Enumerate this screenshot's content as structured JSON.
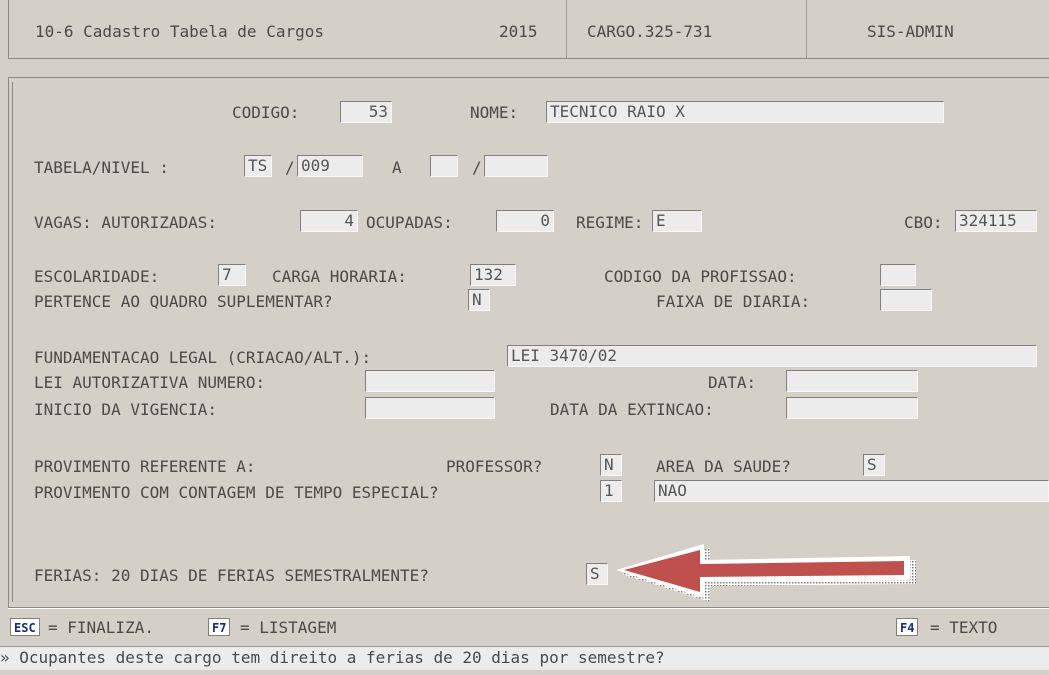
{
  "header": {
    "title": "10-6 Cadastro Tabela de Cargos",
    "year": "2015",
    "code": "CARGO.325-731",
    "user": "SIS-ADMIN"
  },
  "form": {
    "codigo": {
      "label": "CODIGO:",
      "value": "53"
    },
    "nome": {
      "label": "NOME:",
      "value": "TECNICO RAIO X"
    },
    "tabela": {
      "label": "TABELA/NIVEL : ",
      "tabela_value": "TS",
      "sep1": "/",
      "nivel_value": "009",
      "a_label": "A",
      "sep2": "/",
      "tabela_to": "",
      "nivel_to": ""
    },
    "vagas": {
      "label": "VAGAS: AUTORIZADAS:",
      "autorizadas": "4",
      "ocupadas_label": "OCUPADAS:",
      "ocupadas": "0",
      "regime_label": "REGIME:",
      "regime": "E",
      "cbo_label": "CBO:",
      "cbo": "324115"
    },
    "escolaridade": {
      "label": "ESCOLARIDADE:",
      "value": "7",
      "carga_label": "CARGA HORARIA:",
      "carga": "132",
      "prof_label": "CODIGO DA PROFISSAO:",
      "prof": ""
    },
    "suplementar": {
      "label": "PERTENCE AO QUADRO SUPLEMENTAR?",
      "value": "N",
      "faixa_label": "FAIXA DE DIARIA:",
      "faixa": ""
    },
    "legal": {
      "fund_label": "FUNDAMENTACAO LEGAL (CRIACAO/ALT.):",
      "fund": "LEI 3470/02",
      "lei_label": "LEI AUTORIZATIVA NUMERO:",
      "lei": "",
      "data_label": "DATA:",
      "data": "",
      "inicio_label": "INICIO DA VIGENCIA:",
      "inicio": "",
      "extincao_label": "DATA DA EXTINCAO:",
      "extincao": ""
    },
    "provimento": {
      "label": "PROVIMENTO REFERENTE A:",
      "professor_label": "PROFESSOR?",
      "professor": "N",
      "saude_label": "AREA DA SAUDE?",
      "saude": "S",
      "contagem_label": "PROVIMENTO COM CONTAGEM DE TEMPO ESPECIAL?",
      "contagem": "1",
      "contagem_desc": "NAO"
    },
    "ferias": {
      "label": "FERIAS: 20 DIAS DE FERIAS SEMESTRALMENTE?",
      "value": "S"
    }
  },
  "footer": {
    "esc_key": "ESC",
    "esc_label": "= FINALIZA.",
    "f7_key": "F7",
    "f7_label": "= LISTAGEM",
    "f4_key": "F4",
    "f4_label": "= TEXTO"
  },
  "message": "» Ocupantes deste cargo tem direito a ferias de 20 dias por semestre?",
  "colors": {
    "arrow": "#c0504d",
    "background": "#d4d0c8",
    "key_text": "#1b2a7a"
  }
}
